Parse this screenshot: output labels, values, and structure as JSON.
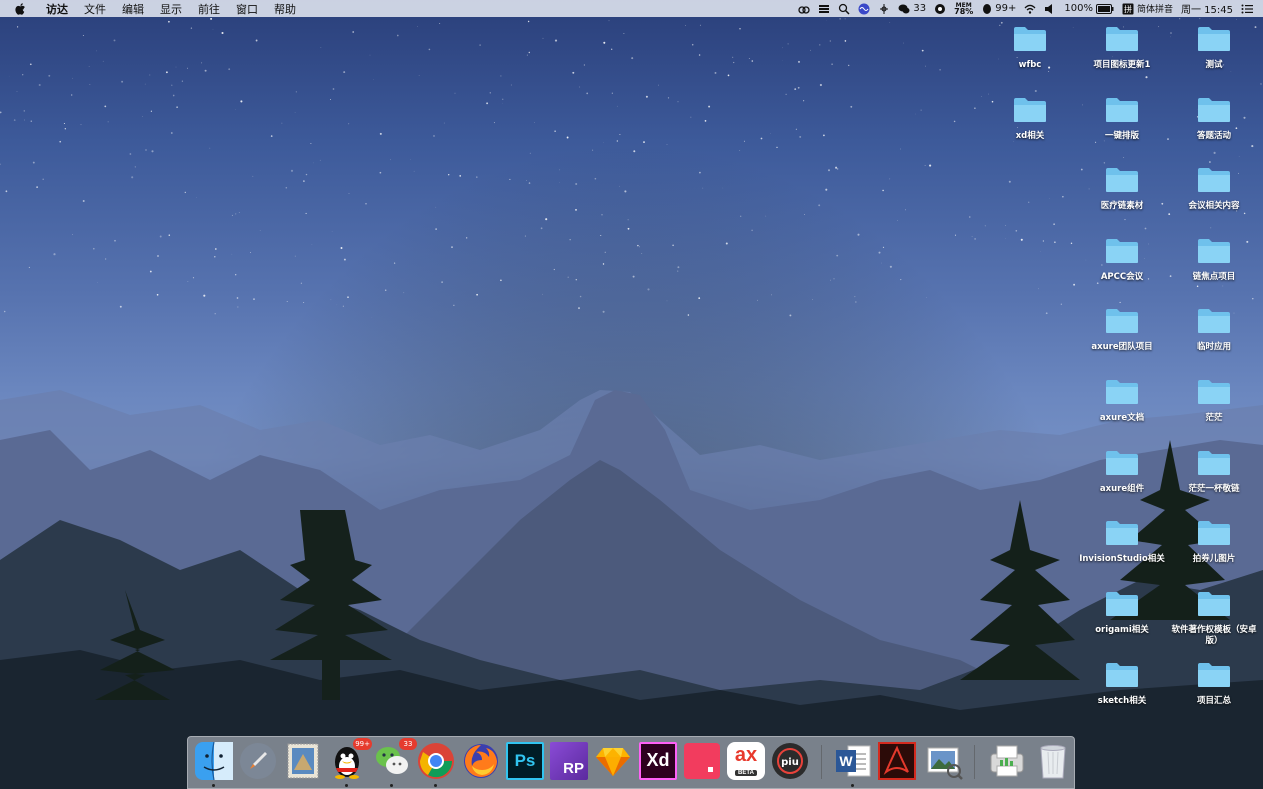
{
  "menubar": {
    "app_name": "访达",
    "menus": [
      "文件",
      "编辑",
      "显示",
      "前往",
      "窗口",
      "帮助"
    ],
    "status": {
      "wechat_count": "33",
      "mem_label": "MEM",
      "mem_value": "78%",
      "qq_count": "99+",
      "battery": "100%",
      "input_method": "简体拼音",
      "clock": "周一 15:45"
    }
  },
  "desktop_icons": [
    {
      "label": "wfbc"
    },
    {
      "label": "项目图标更新1"
    },
    {
      "label": "测试"
    },
    {
      "label": "xd相关"
    },
    {
      "label": "一键排版"
    },
    {
      "label": "答题活动"
    },
    {
      "label": "医疗链素材"
    },
    {
      "label": "会议相关内容"
    },
    {
      "label": "APCC会议"
    },
    {
      "label": "链焦点项目"
    },
    {
      "label": "axure团队项目"
    },
    {
      "label": "临时应用"
    },
    {
      "label": "axure文档"
    },
    {
      "label": "茫茫"
    },
    {
      "label": "axure组件"
    },
    {
      "label": "茫茫一杯敬链"
    },
    {
      "label": "InvisionStudio相关"
    },
    {
      "label": "拍券儿图片"
    },
    {
      "label": "origami相关"
    },
    {
      "label": "软件著作权模板（安卓版）"
    },
    {
      "label": "sketch相关"
    },
    {
      "label": "项目汇总"
    }
  ],
  "dock": {
    "apps": [
      {
        "name": "finder-icon",
        "running": true
      },
      {
        "name": "launchpad-icon",
        "running": false
      },
      {
        "name": "mail-stamp-icon",
        "running": false
      },
      {
        "name": "qq-icon",
        "running": true,
        "badge": "99+"
      },
      {
        "name": "wechat-icon",
        "running": true,
        "badge": "33"
      },
      {
        "name": "chrome-icon",
        "running": true
      },
      {
        "name": "firefox-icon",
        "running": false
      },
      {
        "name": "photoshop-icon",
        "running": false,
        "text": "Ps"
      },
      {
        "name": "axure-rp-icon",
        "running": false,
        "text": "RP"
      },
      {
        "name": "sketch-icon",
        "running": false
      },
      {
        "name": "adobe-xd-icon",
        "running": false,
        "text": "Xd"
      },
      {
        "name": "red-square-icon",
        "running": false
      },
      {
        "name": "ax-beta-icon",
        "running": false,
        "text": "ax",
        "sub": "BETA"
      },
      {
        "name": "piu-icon",
        "running": false,
        "text": "piu"
      },
      {
        "name": "word-icon",
        "running": true,
        "text": "W"
      },
      {
        "name": "acrobat-icon",
        "running": false
      },
      {
        "name": "preview-icon",
        "running": false
      },
      {
        "name": "printer-icon",
        "running": false
      },
      {
        "name": "trash-icon",
        "running": false
      }
    ]
  }
}
